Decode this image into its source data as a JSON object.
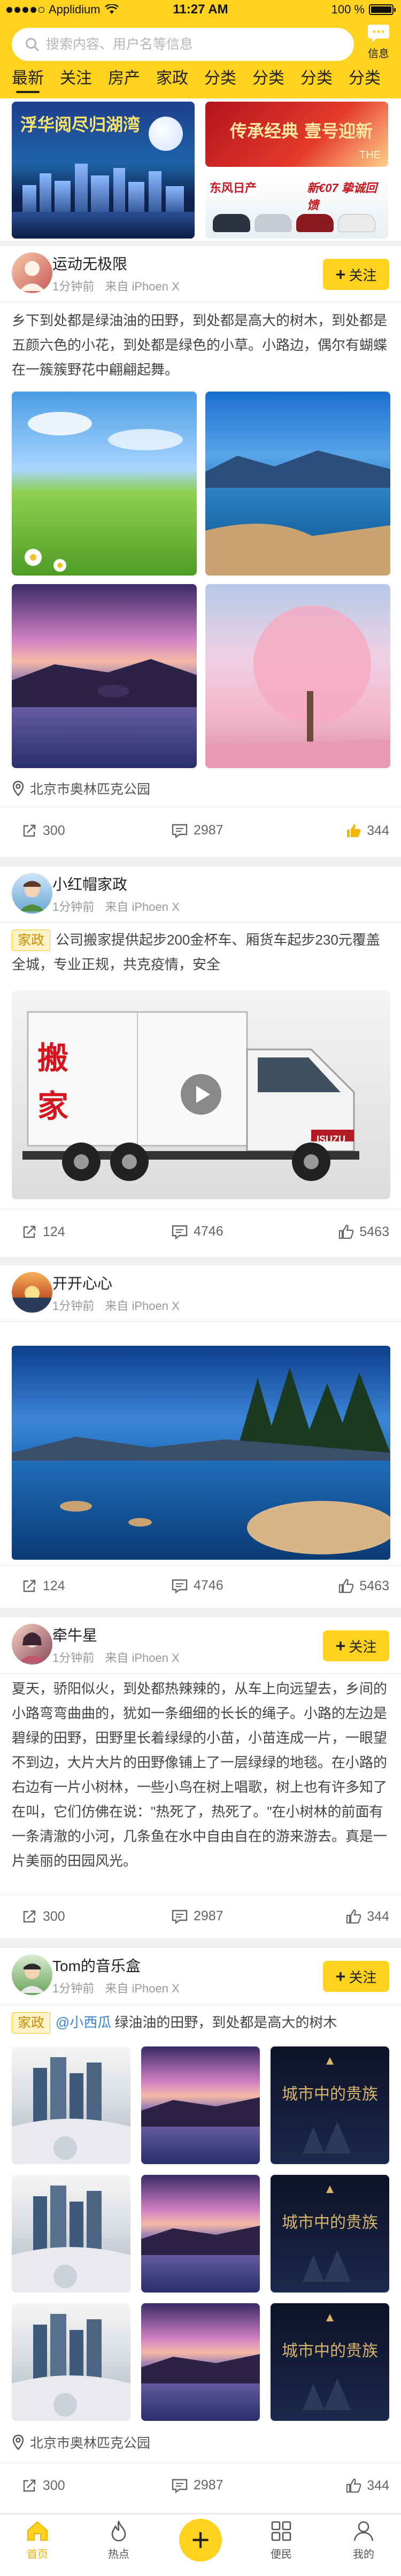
{
  "status_bar": {
    "carrier": "Applidium",
    "time": "11:27 AM",
    "battery": "100 %",
    "battery_level": 1.0
  },
  "search": {
    "placeholder": "搜索内容、用户名等信息"
  },
  "message": {
    "label": "信息"
  },
  "tabs": [
    {
      "label": "最新",
      "active": true
    },
    {
      "label": "关注"
    },
    {
      "label": "房产"
    },
    {
      "label": "家政"
    },
    {
      "label": "分类"
    },
    {
      "label": "分类"
    },
    {
      "label": "分类"
    },
    {
      "label": "分类"
    }
  ],
  "banners": [
    {
      "text": "浮华阅尽归湖湾"
    },
    {
      "text": "传承经典 壹号迎新",
      "sub": "THE"
    },
    {
      "text": "东风日产",
      "text2": "新€07 挚诚回馈"
    }
  ],
  "posts": [
    {
      "name": "运动无极限",
      "time": "1分钟前",
      "source": "来自 iPhoen X",
      "follow": "关注",
      "text": "乡下到处都是绿油油的田野，到处都是高大的树木，到处都是五颜六色的小花，到处都是绿色的小草。小路边，偶尔有蝴蝶在一簇簇野花中翩翩起舞。",
      "location": "北京市奥林匹克公园",
      "shares": "300",
      "comments": "2987",
      "likes": "344"
    },
    {
      "name": "小红帽家政",
      "time": "1分钟前",
      "source": "来自 iPhoen X",
      "tag": "家政",
      "text": "公司搬家提供起步200金杯车、厢货车起步230元覆盖全城，专业正规，共克疫情，安全",
      "truck_text": "搬家",
      "truck_brand": "ISUZU",
      "shares": "124",
      "comments": "4746",
      "likes": "5463"
    },
    {
      "name": "开开心心",
      "time": "1分钟前",
      "source": "来自 iPhoen X",
      "shares": "124",
      "comments": "4746",
      "likes": "5463"
    },
    {
      "name": "牵牛星",
      "time": "1分钟前",
      "source": "来自 iPhoen X",
      "follow": "关注",
      "text": "夏天，骄阳似火，到处都热辣辣的，从车上向远望去，乡间的小路弯弯曲曲的，犹如一条细细的长长的绳子。小路的左边是碧绿的田野，田野里长着绿绿的小苗，小苗连成一片，一眼望不到边，大片大片的田野像铺上了一层绿绿的地毯。在小路的右边有一片小树林，一些小鸟在树上唱歌，树上也有许多知了在叫，它们仿佛在说：\"热死了，热死了。\"在小树林的前面有一条清澈的小河，几条鱼在水中自由自在的游来游去。真是一片美丽的田园风光。",
      "shares": "300",
      "comments": "2987",
      "likes": "344"
    },
    {
      "name": "Tom的音乐盒",
      "time": "1分钟前",
      "source": "来自 iPhoen X",
      "follow": "关注",
      "tag": "家政",
      "mention": "@小西瓜",
      "text": "绿油油的田野，到处都是高大的树木",
      "ad_caption": "城市中的贵族",
      "location": "北京市奥林匹克公园",
      "shares": "300",
      "comments": "2987",
      "likes": "344"
    }
  ],
  "bottom_nav": [
    {
      "label": "首页",
      "icon": "home-icon",
      "active": true
    },
    {
      "label": "热点",
      "icon": "flame-icon"
    },
    {
      "label": "",
      "icon": "plus-icon"
    },
    {
      "label": "便民",
      "icon": "grid-icon"
    },
    {
      "label": "我的",
      "icon": "person-icon"
    }
  ],
  "colors": {
    "accent": "#ffd21e",
    "tag_text": "#d38a00",
    "link": "#3a82d8"
  }
}
